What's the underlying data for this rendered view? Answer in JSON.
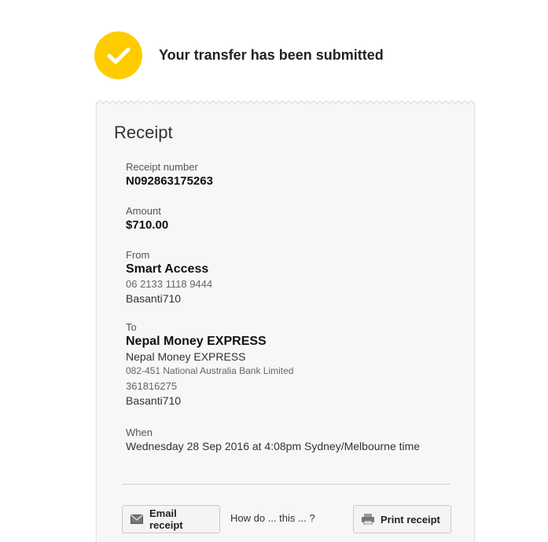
{
  "status": {
    "message": "Your transfer has been submitted"
  },
  "receipt": {
    "title": "Receipt",
    "receipt_number": {
      "label": "Receipt number",
      "value": "N092863175263"
    },
    "amount": {
      "label": "Amount",
      "value": "$710.00"
    },
    "from": {
      "label": "From",
      "account_name": "Smart Access",
      "account_number": "06 2133 1118 9444",
      "reference": "Basanti710"
    },
    "to": {
      "label": "To",
      "payee_name": "Nepal Money EXPRESS",
      "payee_alias": "Nepal Money EXPRESS",
      "bsb_bank": "082-451 National Australia Bank Limited",
      "account_number": "361816275",
      "reference": "Basanti710"
    },
    "when": {
      "label": "When",
      "value": "Wednesday 28 Sep 2016 at 4:08pm Sydney/Melbourne time"
    },
    "actions": {
      "email_label": "Email receipt",
      "inline_text": "How do ... this ... ?",
      "print_label": "Print receipt"
    }
  },
  "colors": {
    "accent": "#ffcc00",
    "background": "#ffffff",
    "card": "#f7f7f7"
  },
  "icons": {
    "status": "check-icon",
    "email": "mail-icon",
    "print": "printer-icon"
  }
}
